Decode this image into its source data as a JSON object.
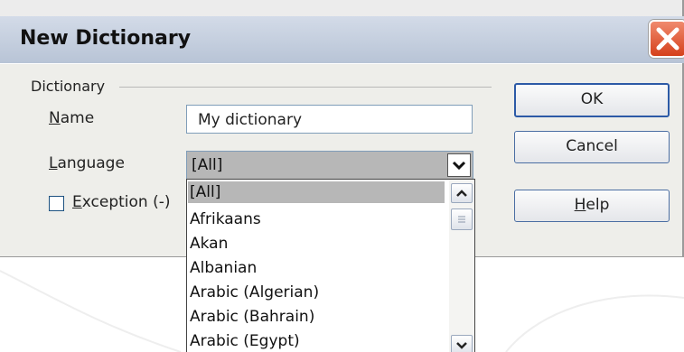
{
  "dialog": {
    "title": "New Dictionary",
    "group_label": "Dictionary",
    "name": {
      "label_prefix": "",
      "label_mnemonic": "N",
      "label_rest": "ame",
      "value": "My dictionary"
    },
    "language": {
      "label_prefix": "",
      "label_mnemonic": "L",
      "label_rest": "anguage",
      "selected": "[All]"
    },
    "exception": {
      "label_mnemonic": "E",
      "label_rest": "xception (-)",
      "checked": false
    },
    "buttons": {
      "ok": "OK",
      "cancel": "Cancel",
      "help_mnemonic": "H",
      "help_rest": "elp"
    }
  },
  "dropdown": {
    "items": [
      "[All]",
      "Afrikaans",
      "Akan",
      "Albanian",
      "Arabic (Algerian)",
      "Arabic (Bahrain)",
      "Arabic (Egypt)"
    ],
    "selected_index": 0
  },
  "icons": {
    "close": "close-icon",
    "dropdown_arrow": "chevron-down-icon",
    "scroll_up": "chevron-up-icon",
    "scroll_down": "chevron-down-icon"
  },
  "colors": {
    "close_button": "#d5401b",
    "selection": "#b7b7b7",
    "button_border": "#4b6ea3"
  }
}
